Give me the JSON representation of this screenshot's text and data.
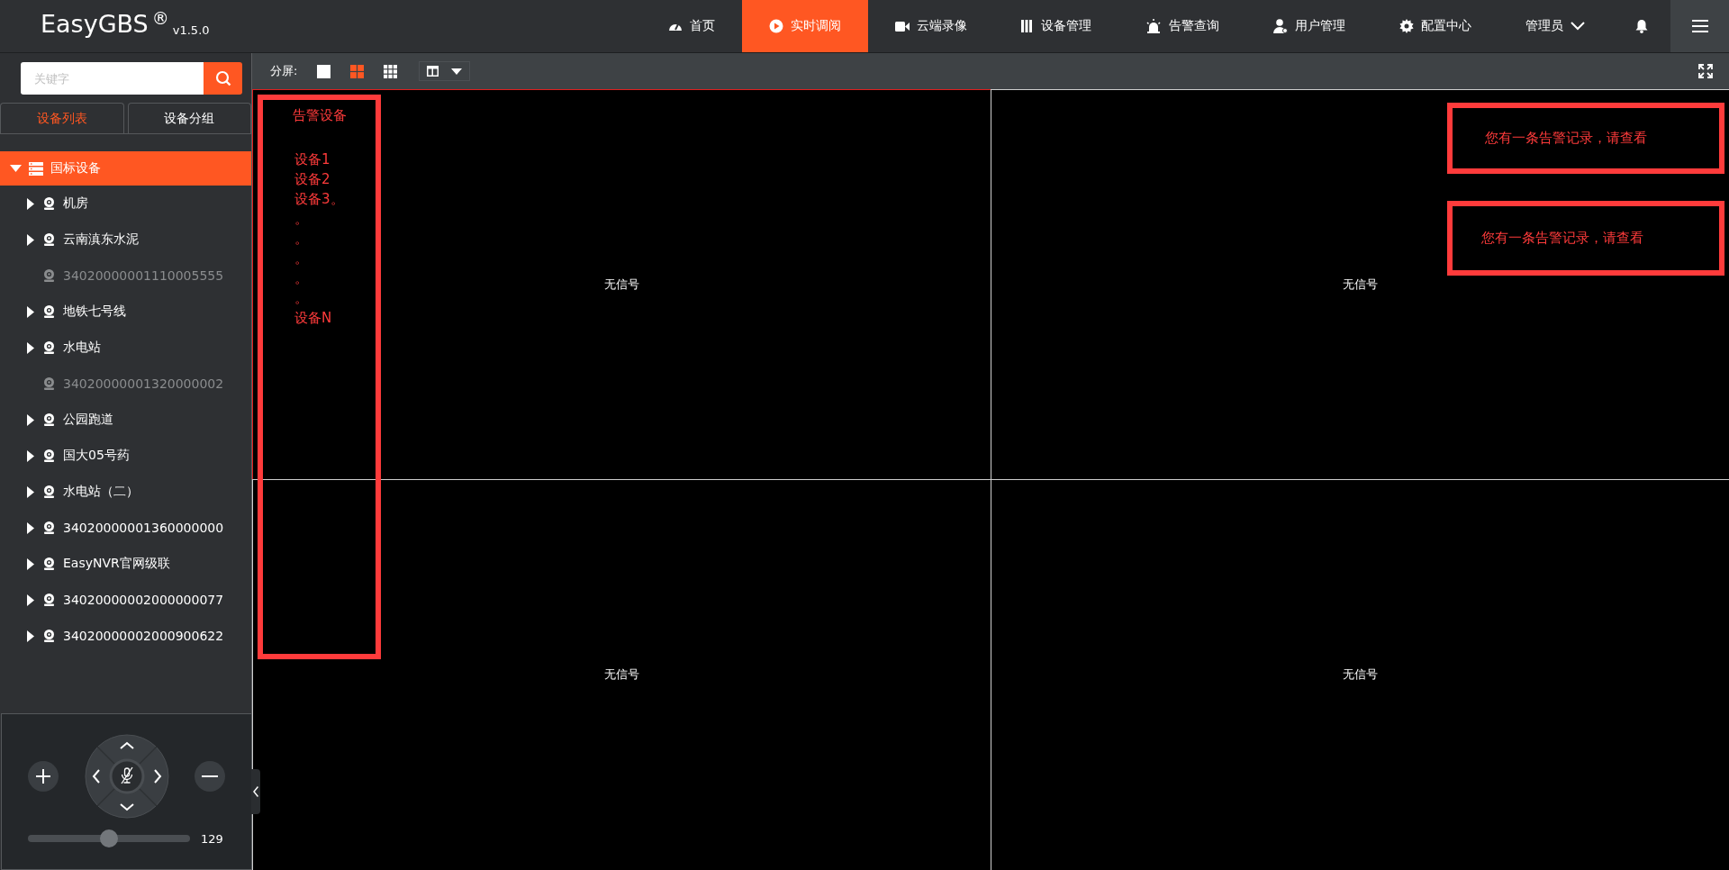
{
  "header": {
    "logo": "EasyGBS",
    "logo_mark": "®",
    "version": "v1.5.0",
    "nav": [
      {
        "label": "首页",
        "selected": false
      },
      {
        "label": "实时调阅",
        "selected": true
      },
      {
        "label": "云端录像",
        "selected": false
      },
      {
        "label": "设备管理",
        "selected": false
      },
      {
        "label": "告警查询",
        "selected": false
      },
      {
        "label": "用户管理",
        "selected": false
      },
      {
        "label": "配置中心",
        "selected": false
      }
    ],
    "user": "管理员"
  },
  "sidebar": {
    "search": {
      "placeholder": "关键字"
    },
    "tabs": [
      {
        "label": "设备列表",
        "selected": true
      },
      {
        "label": "设备分组",
        "selected": false
      }
    ],
    "tree": [
      {
        "label": "国标设备",
        "expanded": true,
        "selected": true,
        "children": [
          {
            "label": "机房",
            "online": true,
            "has_children": true
          },
          {
            "label": "云南滇东水泥",
            "online": true,
            "has_children": true
          },
          {
            "label": "34020000001110005555",
            "online": false,
            "has_children": false
          },
          {
            "label": "地铁七号线",
            "online": true,
            "has_children": true
          },
          {
            "label": "水电站",
            "online": true,
            "has_children": true
          },
          {
            "label": "34020000001320000002",
            "online": false,
            "has_children": false
          },
          {
            "label": "公园跑道",
            "online": true,
            "has_children": true
          },
          {
            "label": "国大05号药",
            "online": true,
            "has_children": true
          },
          {
            "label": "水电站（二）",
            "online": true,
            "has_children": true
          },
          {
            "label": "34020000001360000000",
            "online": true,
            "has_children": true
          },
          {
            "label": "EasyNVR官网级联",
            "online": true,
            "has_children": true
          },
          {
            "label": "34020000002000000077",
            "online": true,
            "has_children": true
          },
          {
            "label": "34020000002000900622",
            "online": true,
            "has_children": true
          }
        ]
      }
    ]
  },
  "ptz": {
    "speed": {
      "level": 0.5,
      "reading": "129"
    }
  },
  "toolbar": {
    "label": "分屏:",
    "layouts": [
      {
        "kind": "single",
        "selected": false
      },
      {
        "kind": "quad",
        "selected": true
      },
      {
        "kind": "nine",
        "selected": false
      }
    ]
  },
  "video": {
    "cells": [
      {
        "text": "无信号",
        "selected": true
      },
      {
        "text": "无信号",
        "selected": false
      },
      {
        "text": "无信号",
        "selected": false
      },
      {
        "text": "无信号",
        "selected": false
      }
    ]
  },
  "annotations": {
    "device_panel": {
      "title": "告警设备",
      "lines": [
        "设备1",
        "设备2",
        "设备3。",
        "。",
        "。",
        "。",
        "。",
        "。",
        "设备N"
      ]
    },
    "alerts": [
      "您有一条告警记录，请查看",
      "您有一条告警记录，请查看"
    ]
  }
}
